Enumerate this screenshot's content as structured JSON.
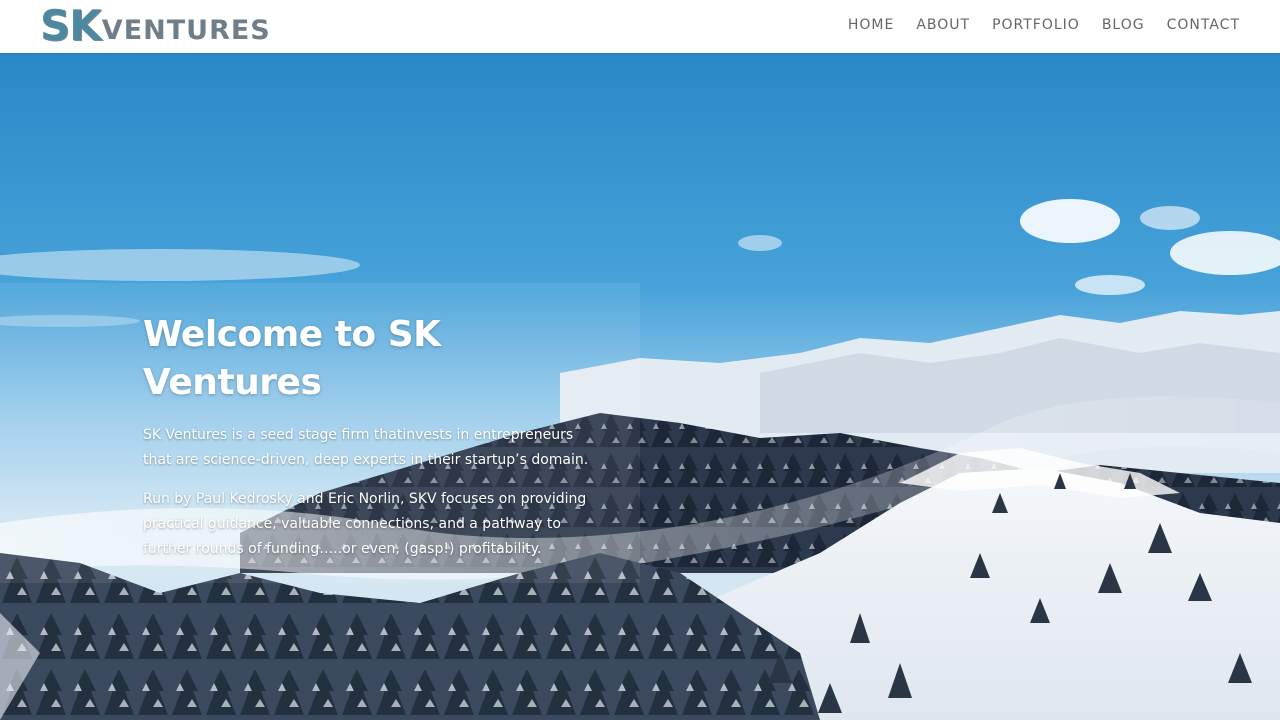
{
  "header": {
    "logo": {
      "sk": "SK",
      "ventures": "VENTURES"
    },
    "nav": [
      {
        "label": "HOME"
      },
      {
        "label": "ABOUT"
      },
      {
        "label": "PORTFOLIO"
      },
      {
        "label": "BLOG"
      },
      {
        "label": "CONTACT"
      }
    ]
  },
  "hero": {
    "title": "Welcome to SK Ventures",
    "paragraphs": [
      "SK Ventures is a seed stage firm thatinvests in entrepreneurs that are science-driven, deep experts in their startup’s domain.",
      "Run by Paul Kedrosky and Eric Norlin, SKV focuses on providing practical guidance, valuable connections, and a pathway to further rounds of funding…..or even, (gasp!) profitability."
    ],
    "background": "snowy-mountain-forest-image"
  },
  "colors": {
    "logo_blue": "#4e87a0",
    "logo_gray": "#6f7e89",
    "nav_text": "#666666",
    "hero_text": "#ffffff",
    "sky": "#2d8bc8"
  }
}
